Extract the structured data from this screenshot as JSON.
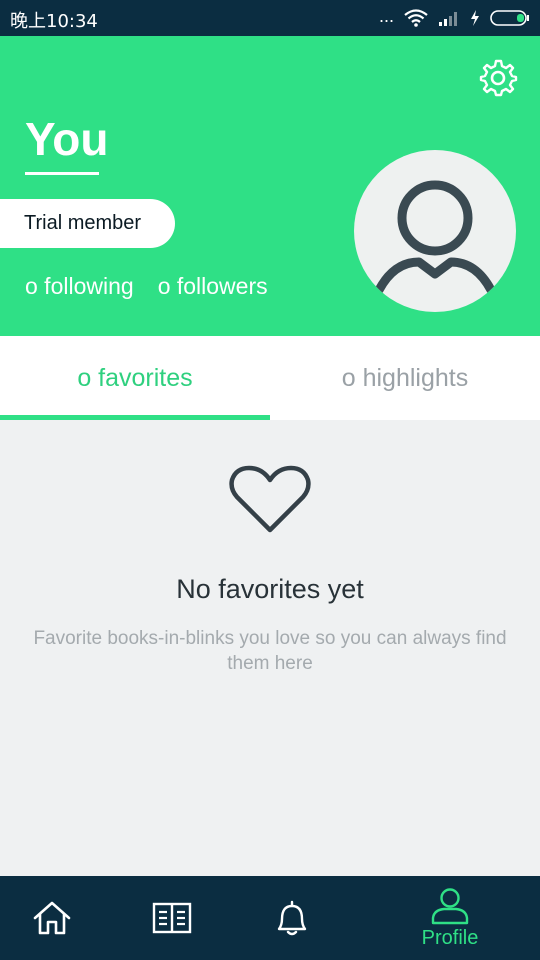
{
  "status_bar": {
    "time": "晚上10:34",
    "dots": "..."
  },
  "header": {
    "title": "You",
    "membership": "Trial member",
    "following": "o following",
    "followers": "o followers",
    "accent_color": "#2fe086"
  },
  "tabs": [
    {
      "label": "o favorites",
      "active": true
    },
    {
      "label": "o highlights",
      "active": false
    }
  ],
  "empty_state": {
    "title": "No favorites yet",
    "description": "Favorite books-in-blinks you love so you can always find them here",
    "icon": "heart-icon"
  },
  "bottom_nav": {
    "items": [
      {
        "icon": "home-icon",
        "label": ""
      },
      {
        "icon": "book-icon",
        "label": ""
      },
      {
        "icon": "bell-icon",
        "label": ""
      },
      {
        "icon": "profile-icon",
        "label": "Profile",
        "active": true
      }
    ],
    "background": "#0b2d41"
  }
}
